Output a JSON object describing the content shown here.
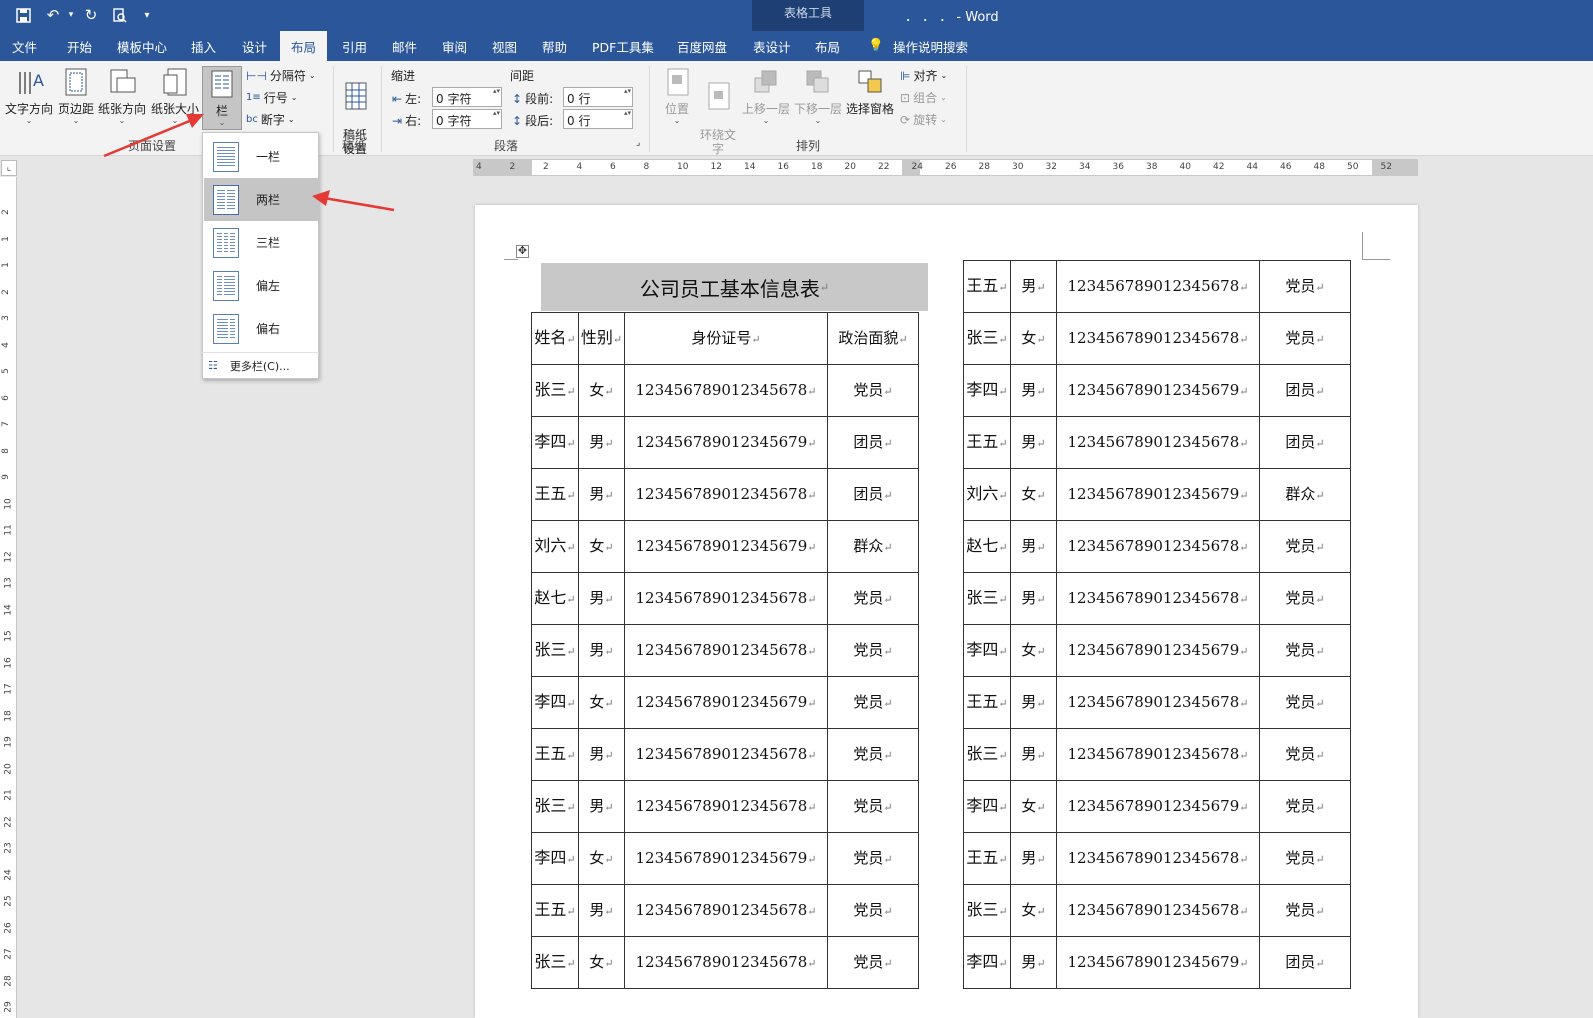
{
  "window": {
    "title": "． ． ．  -  Word",
    "context_group": "表格工具"
  },
  "quick_access": {
    "save": "save-icon",
    "undo": "undo-icon",
    "redo": "redo-icon",
    "preview": "print-preview-icon",
    "customize": "▾"
  },
  "tabs": [
    "文件",
    "开始",
    "模板中心",
    "插入",
    "设计",
    "布局",
    "引用",
    "邮件",
    "审阅",
    "视图",
    "帮助",
    "PDF工具集",
    "百度网盘",
    "表设计",
    "布局",
    "操作说明搜索"
  ],
  "active_tab_index": 5,
  "ribbon": {
    "page_setup": {
      "text_direction": "文字方向",
      "margins": "页边距",
      "orientation": "纸张方向",
      "size": "纸张大小",
      "columns": "栏",
      "breaks": "分隔符",
      "line_numbers": "行号",
      "hyphenation": "断字",
      "group": "页面设置"
    },
    "manuscript": {
      "label": "稿纸\n设置",
      "group": "稿纸"
    },
    "paragraph": {
      "indent_title": "缩进",
      "spacing_title": "间距",
      "left_label": "左:",
      "left_value": "0 字符",
      "right_label": "右:",
      "right_value": "0 字符",
      "before_label": "段前:",
      "before_value": "0 行",
      "after_label": "段后:",
      "after_value": "0 行",
      "group": "段落"
    },
    "arrange": {
      "position": "位置",
      "wrap_text": "环绕文\n字",
      "bring_forward": "上移一层",
      "send_backward": "下移一层",
      "selection_pane": "选择窗格",
      "align": "对齐",
      "group_btn": "组合",
      "rotate": "旋转",
      "group": "排列"
    }
  },
  "columns_menu": {
    "items": [
      "一栏",
      "两栏",
      "三栏",
      "偏左",
      "偏右"
    ],
    "selected_index": 1,
    "more": "更多栏(C)..."
  },
  "ruler": {
    "h_numbers": [
      "4",
      "2",
      "2",
      "4",
      "6",
      "8",
      "10",
      "12",
      "14",
      "16",
      "18",
      "20",
      "22",
      "24",
      "26",
      "28",
      "30",
      "32",
      "34",
      "36",
      "38",
      "40",
      "42",
      "44",
      "46",
      "48",
      "50",
      "52"
    ],
    "v_numbers": [
      "2",
      "1",
      "1",
      "2",
      "3",
      "4",
      "5",
      "6",
      "7",
      "8",
      "9",
      "10",
      "11",
      "12",
      "13",
      "14",
      "15",
      "16",
      "17",
      "18",
      "19",
      "20",
      "21",
      "22",
      "23",
      "24",
      "25",
      "26",
      "27",
      "28",
      "29"
    ]
  },
  "document": {
    "table_title": "公司员工基本信息表",
    "paragraph_mark": "↵",
    "headers": [
      "姓名",
      "性别",
      "身份证号",
      "政治面貌"
    ],
    "left_rows": [
      [
        "张三",
        "女",
        "123456789012345678",
        "党员"
      ],
      [
        "李四",
        "男",
        "123456789012345679",
        "团员"
      ],
      [
        "王五",
        "男",
        "123456789012345678",
        "团员"
      ],
      [
        "刘六",
        "女",
        "123456789012345679",
        "群众"
      ],
      [
        "赵七",
        "男",
        "123456789012345678",
        "党员"
      ],
      [
        "张三",
        "男",
        "123456789012345678",
        "党员"
      ],
      [
        "李四",
        "女",
        "123456789012345679",
        "党员"
      ],
      [
        "王五",
        "男",
        "123456789012345678",
        "党员"
      ],
      [
        "张三",
        "男",
        "123456789012345678",
        "党员"
      ],
      [
        "李四",
        "女",
        "123456789012345679",
        "党员"
      ],
      [
        "王五",
        "男",
        "123456789012345678",
        "党员"
      ],
      [
        "张三",
        "女",
        "123456789012345678",
        "党员"
      ]
    ],
    "right_rows": [
      [
        "王五",
        "男",
        "123456789012345678",
        "党员"
      ],
      [
        "张三",
        "女",
        "123456789012345678",
        "党员"
      ],
      [
        "李四",
        "男",
        "123456789012345679",
        "团员"
      ],
      [
        "王五",
        "男",
        "123456789012345678",
        "团员"
      ],
      [
        "刘六",
        "女",
        "123456789012345679",
        "群众"
      ],
      [
        "赵七",
        "男",
        "123456789012345678",
        "党员"
      ],
      [
        "张三",
        "男",
        "123456789012345678",
        "党员"
      ],
      [
        "李四",
        "女",
        "123456789012345679",
        "党员"
      ],
      [
        "王五",
        "男",
        "123456789012345678",
        "党员"
      ],
      [
        "张三",
        "男",
        "123456789012345678",
        "党员"
      ],
      [
        "李四",
        "女",
        "123456789012345679",
        "党员"
      ],
      [
        "王五",
        "男",
        "123456789012345678",
        "党员"
      ],
      [
        "张三",
        "女",
        "123456789012345678",
        "党员"
      ],
      [
        "李四",
        "男",
        "123456789012345679",
        "团员"
      ]
    ]
  },
  "colors": {
    "brand": "#2b579a",
    "context": "#1e3f73",
    "arrow": "#e53935",
    "selected_menu": "#c5c5c5",
    "title_fill": "#c8c8c8"
  }
}
